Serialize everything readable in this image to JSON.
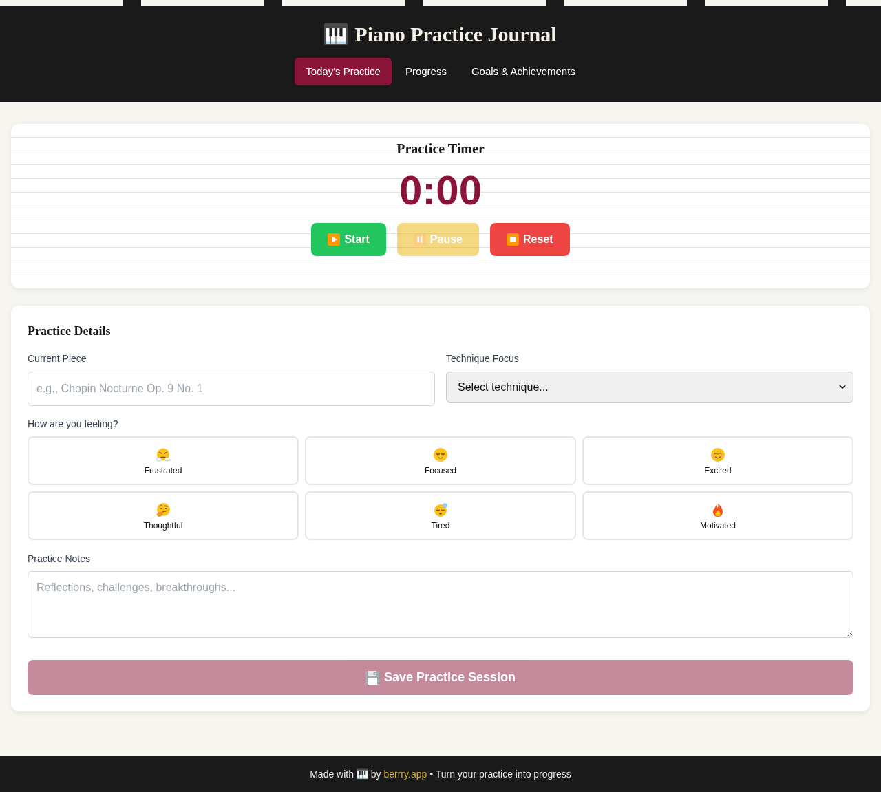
{
  "header": {
    "title": "Piano Practice Journal"
  },
  "nav": {
    "tabs": [
      {
        "label": "Today's Practice",
        "selected": true
      },
      {
        "label": "Progress",
        "selected": false
      },
      {
        "label": "Goals & Achievements",
        "selected": false
      }
    ]
  },
  "timer": {
    "title": "Practice Timer",
    "time": "0:00",
    "buttons": [
      {
        "kind": "start",
        "label": "Start",
        "disabled": false
      },
      {
        "kind": "pause",
        "label": "Pause",
        "disabled": true
      },
      {
        "kind": "reset",
        "label": "Reset",
        "disabled": false
      }
    ]
  },
  "details": {
    "title": "Practice Details",
    "piece": {
      "label": "Current Piece",
      "placeholder": "e.g., Chopin Nocturne Op. 9 No. 1"
    },
    "technique": {
      "label": "Technique Focus",
      "value": "Select technique..."
    },
    "mood": {
      "label": "How are you feeling?",
      "options": [
        {
          "label": "Frustrated",
          "selected": false
        },
        {
          "label": "Focused",
          "selected": false
        },
        {
          "label": "Excited",
          "selected": false
        },
        {
          "label": "Thoughtful",
          "selected": false
        },
        {
          "label": "Tired",
          "selected": false
        },
        {
          "label": "Motivated",
          "selected": false
        }
      ]
    },
    "notes": {
      "label": "Practice Notes",
      "placeholder": "Reflections, challenges, breakthroughs..."
    },
    "save_button": {
      "label": "Save Practice Session",
      "disabled": true
    }
  },
  "footer": {
    "text_before": "Made with",
    "text_middle": "by",
    "link": "berrry.app",
    "text_after": "• Turn your practice into progress"
  }
}
